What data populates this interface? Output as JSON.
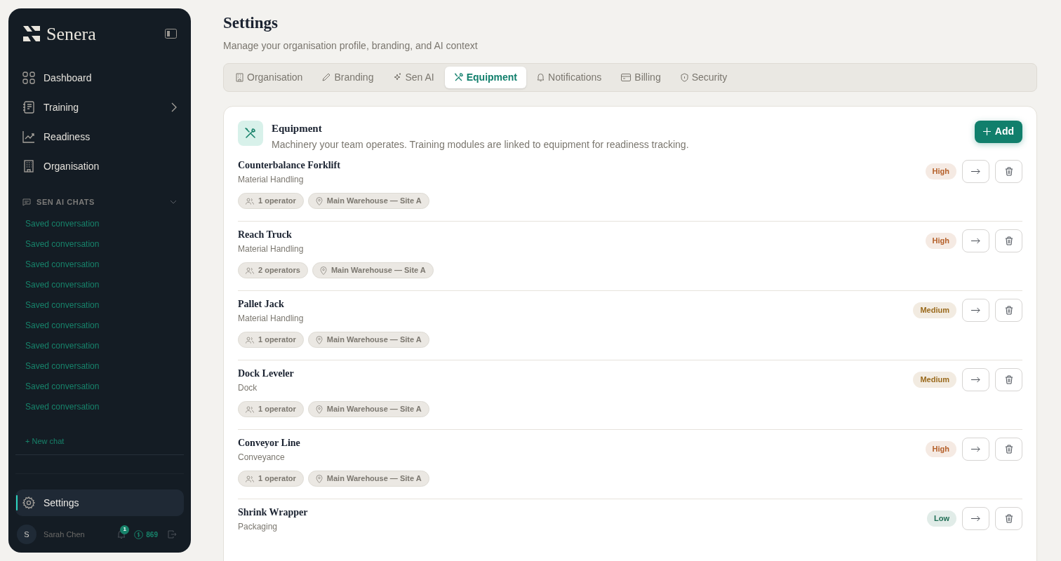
{
  "sidebar": {
    "brand": "Senera",
    "nav": [
      {
        "label": "Dashboard",
        "selected": false,
        "expandable": false
      },
      {
        "label": "Training",
        "selected": false,
        "expandable": true
      },
      {
        "label": "Readiness",
        "selected": false,
        "expandable": false
      },
      {
        "label": "Organisation",
        "selected": false,
        "expandable": false
      }
    ],
    "chats_heading": "SEN AI CHATS",
    "chats": [
      "Saved conversation",
      "Saved conversation",
      "Saved conversation",
      "Saved conversation",
      "Saved conversation",
      "Saved conversation",
      "Saved conversation",
      "Saved conversation",
      "Saved conversation",
      "Saved conversation"
    ],
    "new_chat": "+ New chat",
    "settings": {
      "label": "Settings",
      "selected": true
    },
    "user": {
      "initial": "S",
      "name": "Sarah Chen",
      "notifications": "1",
      "credits": "869"
    }
  },
  "header": {
    "title": "Settings",
    "subtitle": "Manage your organisation profile, branding, and AI context"
  },
  "tabs": [
    {
      "label": "Organisation",
      "selected": false
    },
    {
      "label": "Branding",
      "selected": false
    },
    {
      "label": "Sen AI",
      "selected": false
    },
    {
      "label": "Equipment",
      "selected": true
    },
    {
      "label": "Notifications",
      "selected": false
    },
    {
      "label": "Billing",
      "selected": false
    },
    {
      "label": "Security",
      "selected": false
    }
  ],
  "panel": {
    "title": "Equipment",
    "description": "Machinery your team operates. Training modules are linked to equipment for readiness tracking.",
    "add_button": "Add",
    "items": [
      {
        "name": "Counterbalance Forklift",
        "category": "Material Handling",
        "operators": "1 operator",
        "location": "Main Warehouse — Site A",
        "color": "#b5602a",
        "risk_label": "High"
      },
      {
        "name": "Reach Truck",
        "category": "Material Handling",
        "operators": "2 operators",
        "location": "Main Warehouse — Site A",
        "color": "#b5602a",
        "risk_label": "High"
      },
      {
        "name": "Pallet Jack",
        "category": "Material Handling",
        "operators": "1 operator",
        "location": "Main Warehouse — Site A",
        "color": "#9a6a1c",
        "risk_label": "Medium"
      },
      {
        "name": "Dock Leveler",
        "category": "Dock",
        "operators": "1 operator",
        "location": "Main Warehouse — Site A",
        "color": "#9a6a1c",
        "risk_label": "Medium"
      },
      {
        "name": "Conveyor Line",
        "category": "Conveyance",
        "operators": "1 operator",
        "location": "Main Warehouse — Site A",
        "color": "#b5602a",
        "risk_label": "High"
      },
      {
        "name": "Shrink Wrapper",
        "category": "Packaging",
        "color": "#1f6e55",
        "risk_label": "Low"
      }
    ]
  }
}
